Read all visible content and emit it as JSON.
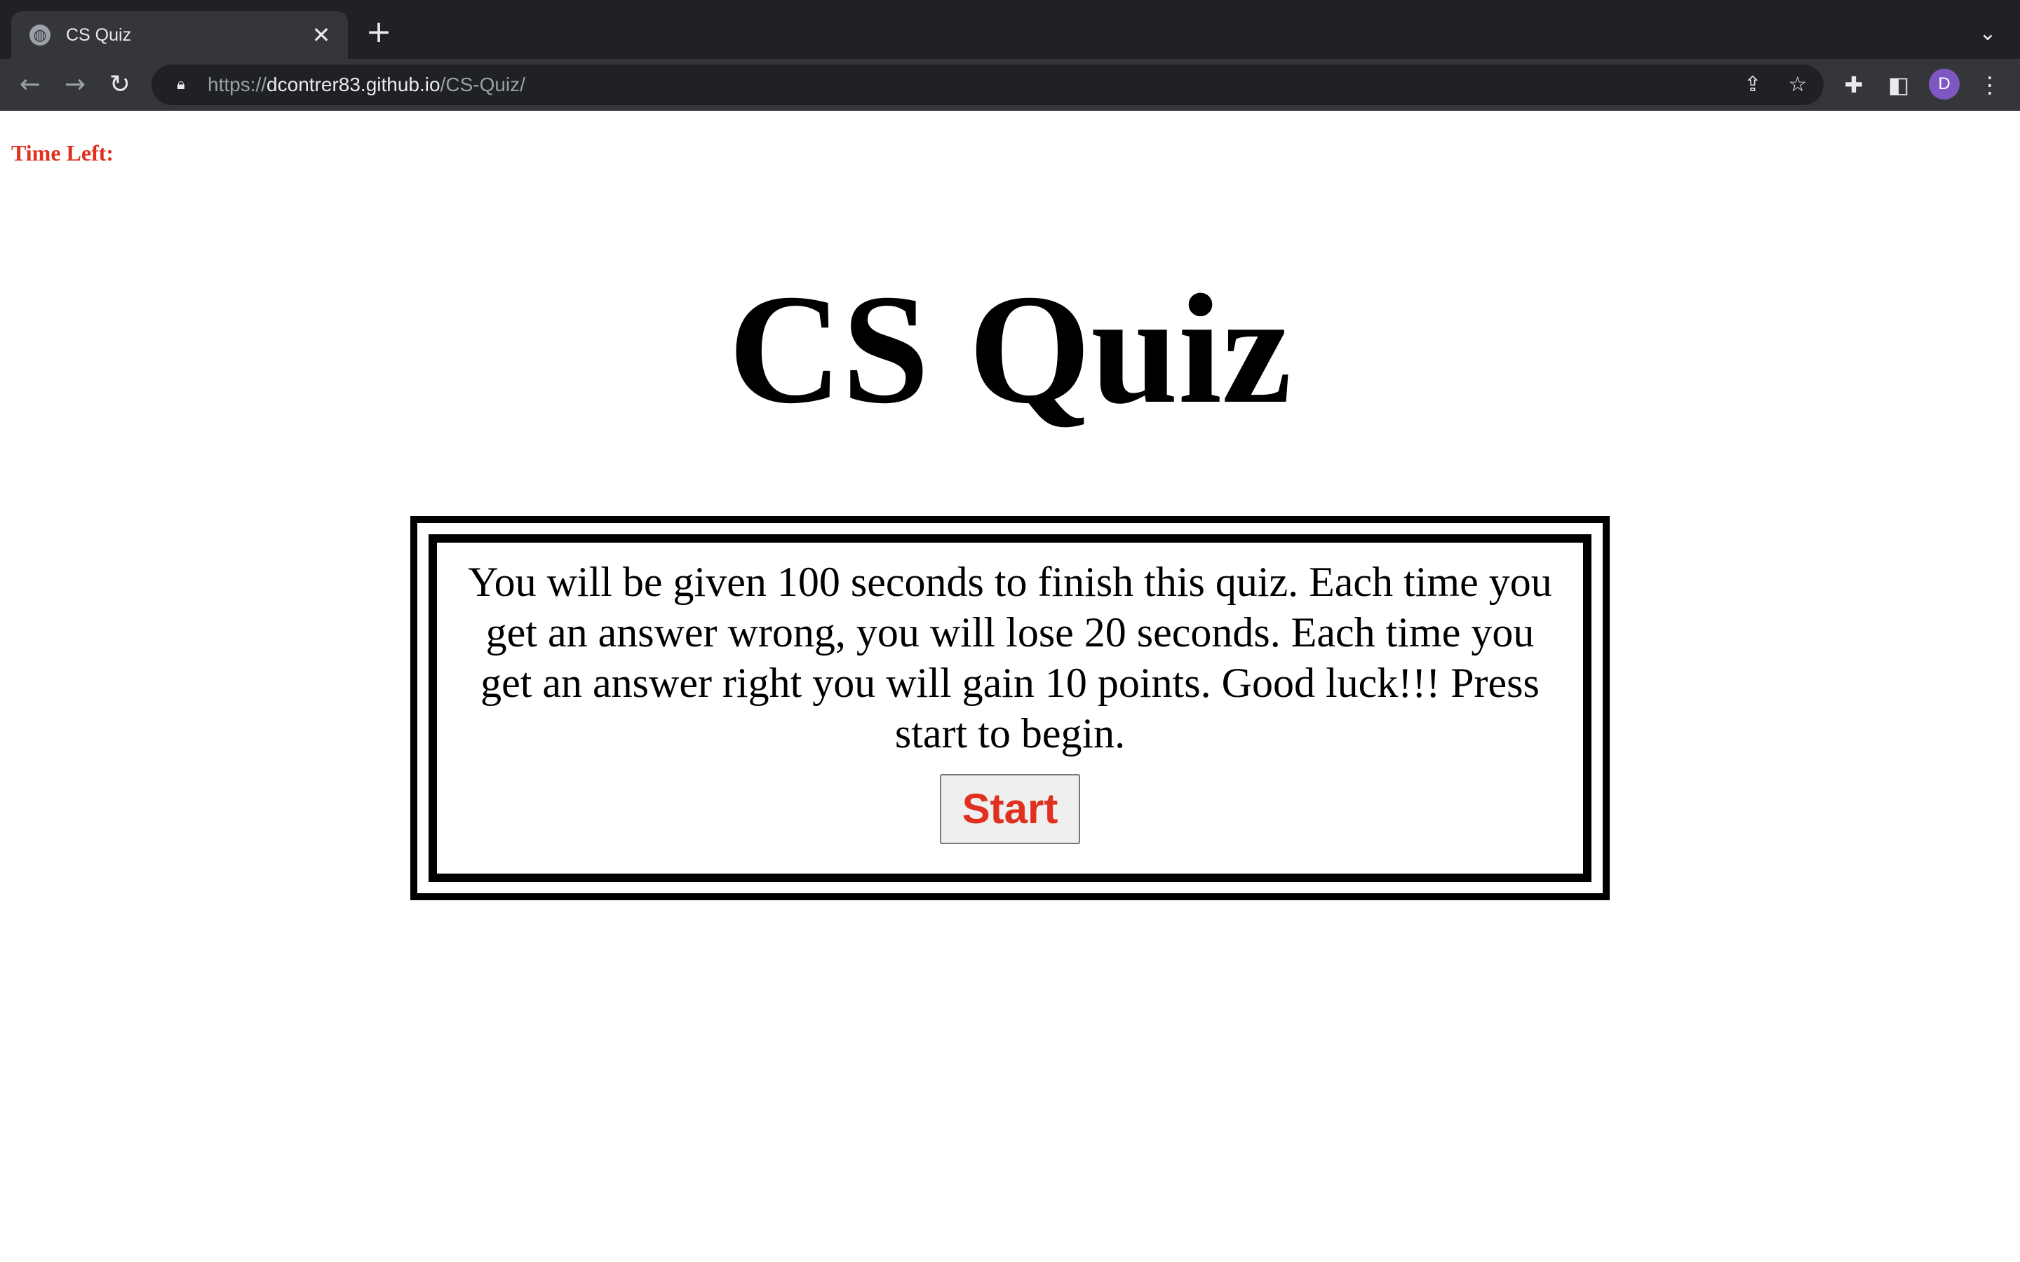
{
  "browser": {
    "tab_title": "CS Quiz",
    "url_scheme": "https://",
    "url_host": "dcontrer83.github.io",
    "url_path": "/CS-Quiz/",
    "profile_initial": "D",
    "icons": [
      "globe-icon",
      "close-icon",
      "plus-icon",
      "chevron-down-icon",
      "back-arrow-icon",
      "forward-arrow-icon",
      "reload-icon",
      "lock-icon",
      "share-icon",
      "star-icon",
      "puzzle-icon",
      "side-panel-icon",
      "kebab-menu-icon"
    ],
    "colors": {
      "frame": "#202124",
      "toolbar": "#35363a",
      "avatar": "#7e57c2"
    }
  },
  "page": {
    "time_left_label": "Time Left:",
    "title": "CS Quiz",
    "instructions": "You will be given 100 seconds to finish this quiz. Each time you get an answer wrong, you will lose 20 seconds. Each time you get an answer right you will gain 10 points. Good luck!!! Press start to begin.",
    "start_label": "Start",
    "colors": {
      "accent": "#e03020",
      "text": "#000000",
      "background": "#ffffff"
    }
  }
}
